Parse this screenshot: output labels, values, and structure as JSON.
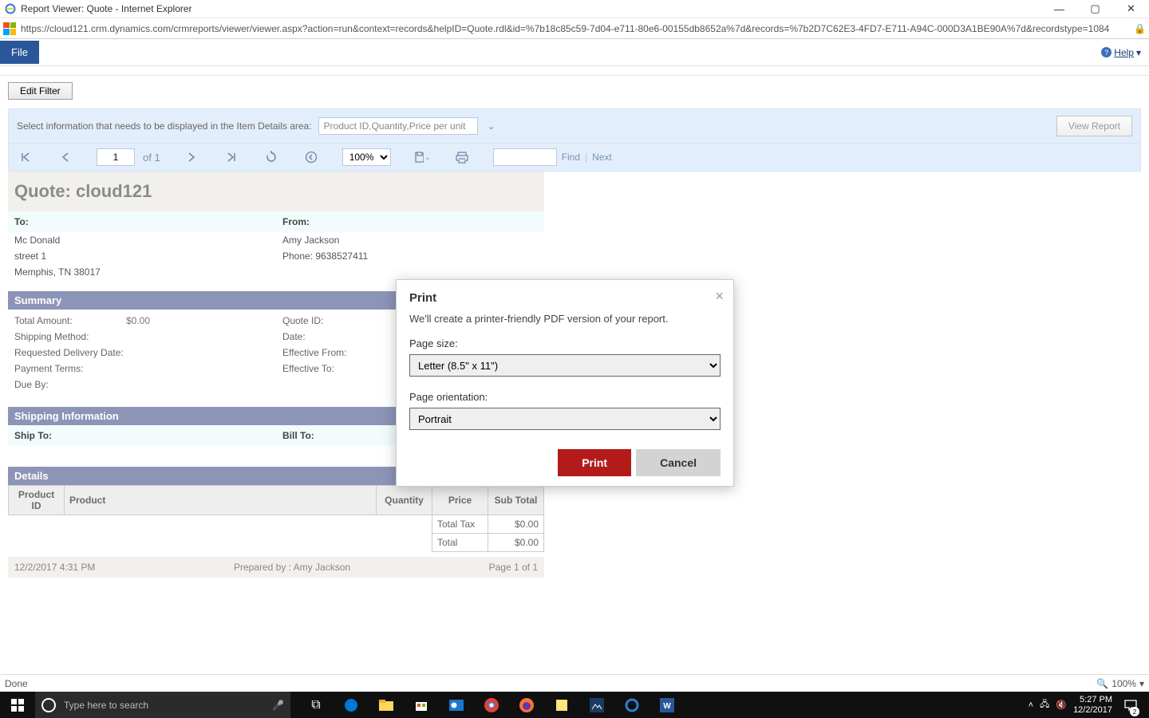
{
  "window": {
    "title": "Report Viewer: Quote - Internet Explorer",
    "url": "https://cloud121.crm.dynamics.com/crmreports/viewer/viewer.aspx?action=run&context=records&helpID=Quote.rdl&id=%7b18c85c59-7d04-e711-80e6-00155db8652a%7d&records=%7b2D7C62E3-4FD7-E711-A94C-000D3A1BE90A%7d&recordstype=1084"
  },
  "menu": {
    "file": "File",
    "help": "Help"
  },
  "filter": {
    "edit_button": "Edit Filter"
  },
  "params": {
    "label": "Select information that needs to be displayed in the Item Details area:",
    "combo_value": "Product ID,Quantity,Price per unit",
    "view_report": "View Report"
  },
  "toolbar": {
    "page_current": "1",
    "page_of": "of 1",
    "zoom": "100%",
    "find": "Find",
    "next": "Next"
  },
  "report": {
    "title": "Quote: cloud121",
    "to_label": "To:",
    "from_label": "From:",
    "to_name": "Mc Donald",
    "to_street": "street 1",
    "to_city": "Memphis, TN 38017",
    "from_name": "Amy Jackson",
    "from_phone": "Phone: 9638527411",
    "summary_header": "Summary",
    "summary_left": [
      {
        "lbl": "Total Amount:",
        "val": "$0.00"
      },
      {
        "lbl": "Shipping Method:",
        "val": ""
      },
      {
        "lbl": "Requested Delivery Date:",
        "val": ""
      },
      {
        "lbl": "Payment Terms:",
        "val": ""
      },
      {
        "lbl": "Due By:",
        "val": ""
      }
    ],
    "summary_right": [
      {
        "lbl": "Quote ID:",
        "val": ""
      },
      {
        "lbl": "Date:",
        "val": ""
      },
      {
        "lbl": "Effective From:",
        "val": ""
      },
      {
        "lbl": "Effective To:",
        "val": ""
      }
    ],
    "shipping_header": "Shipping Information",
    "ship_to": "Ship To:",
    "bill_to": "Bill To:",
    "details_header": "Details",
    "columns": [
      "Product ID",
      "Product",
      "Quantity",
      "Price",
      "Sub Total"
    ],
    "totals": [
      {
        "lbl": "Total Tax",
        "val": "$0.00"
      },
      {
        "lbl": "Total",
        "val": "$0.00"
      }
    ],
    "footer_date": "12/2/2017 4:31 PM",
    "footer_prepared": "Prepared by : Amy Jackson",
    "footer_page": "Page 1 of 1"
  },
  "modal": {
    "title": "Print",
    "desc": "We'll create a printer-friendly PDF version of your report.",
    "pagesize_label": "Page size:",
    "pagesize_value": "Letter (8.5\" x 11\")",
    "orientation_label": "Page orientation:",
    "orientation_value": "Portrait",
    "print": "Print",
    "cancel": "Cancel"
  },
  "statusbar": {
    "done": "Done",
    "zoom": "100%"
  },
  "taskbar": {
    "search_placeholder": "Type here to search",
    "time": "5:27 PM",
    "date": "12/2/2017",
    "notif_count": "2"
  }
}
